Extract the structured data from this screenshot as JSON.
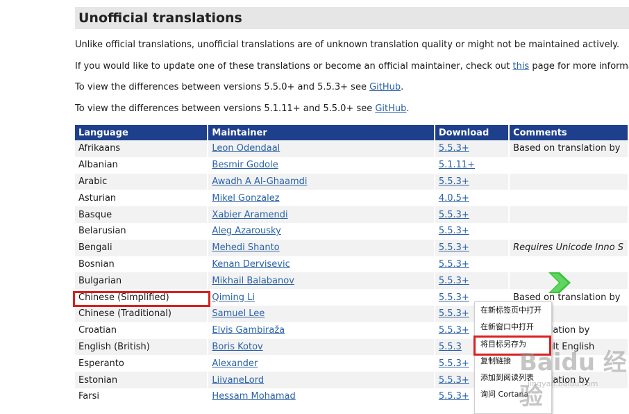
{
  "heading": "Unofficial translations",
  "paragraphs": {
    "p1": "Unlike official translations, unofficial translations are of unknown translation quality or might not be maintained actively.",
    "p2_before": "If you would like to update one of these translations or become an official maintainer, check out ",
    "p2_link": "this",
    "p2_after": " page for more informatio",
    "p3_before": "To view the differences between versions 5.5.0+ and 5.5.3+ see ",
    "p3_link": "GitHub",
    "p3_after": ".",
    "p4_before": "To view the differences between versions 5.1.11+ and 5.5.0+ see ",
    "p4_link": "GitHub",
    "p4_after": "."
  },
  "table": {
    "headers": [
      "Language",
      "Maintainer",
      "Download",
      "Comments"
    ],
    "rows": [
      {
        "language": "Afrikaans",
        "maintainer": "Leon Odendaal",
        "download": "5.5.3+",
        "comment": "Based on translation by"
      },
      {
        "language": "Albanian",
        "maintainer": "Besmir Godole",
        "download": "5.1.11+",
        "comment": ""
      },
      {
        "language": "Arabic",
        "maintainer": "Awadh A Al-Ghaamdi",
        "download": "5.5.3+",
        "comment": ""
      },
      {
        "language": "Asturian",
        "maintainer": "Mikel Gonzalez",
        "download": "4.0.5+",
        "comment": ""
      },
      {
        "language": "Basque",
        "maintainer": "Xabier Aramendi",
        "download": "5.5.3+",
        "comment": ""
      },
      {
        "language": "Belarusian",
        "maintainer": "Aleg Azarousky",
        "download": "5.5.3+",
        "comment": ""
      },
      {
        "language": "Bengali",
        "maintainer": "Mehedi Shanto",
        "download": "5.5.3+",
        "comment": "Requires Unicode Inno S"
      },
      {
        "language": "Bosnian",
        "maintainer": "Kenan Dervisevic",
        "download": "5.5.3+",
        "comment": ""
      },
      {
        "language": "Bulgarian",
        "maintainer": "Mikhail Balabanov",
        "download": "5.5.3+",
        "comment": ""
      },
      {
        "language": "Chinese (Simplified)",
        "maintainer": "Qiming Li",
        "download": "5.5.3+",
        "comment": "Based on translation by"
      },
      {
        "language": "Chinese (Traditional)",
        "maintainer": "Samuel Lee",
        "download": "5.5.3+",
        "comment": ""
      },
      {
        "language": "Croatian",
        "maintainer": "Elvis Gambiraža",
        "download": "5.5.3+",
        "comment": "on translation by"
      },
      {
        "language": "English (British)",
        "maintainer": "Boris Kotov",
        "download": "5.5.3",
        "comment": "on default English"
      },
      {
        "language": "Esperanto",
        "maintainer": "Alexander",
        "download": "5.5.3+",
        "comment": ""
      },
      {
        "language": "Estonian",
        "maintainer": "LiivaneLord",
        "download": "5.5.3+",
        "comment": "on translation by"
      },
      {
        "language": "Farsi",
        "maintainer": "Hessam Mohamad",
        "download": "5.5.3+",
        "comment": ""
      }
    ]
  },
  "context_menu": {
    "items": [
      "在新标签页中打开",
      "在新窗口中打开",
      "将目标另存为",
      "复制链接",
      "添加到阅读列表",
      "询问 Cortana"
    ]
  },
  "watermark": {
    "text": "Baidu 经验",
    "url": "jingyan.baidu.com"
  },
  "colors": {
    "header_bg": "#1e3f8c",
    "link": "#2a62a8",
    "highlight": "#d92020",
    "title_bg": "#e6e6e6"
  }
}
